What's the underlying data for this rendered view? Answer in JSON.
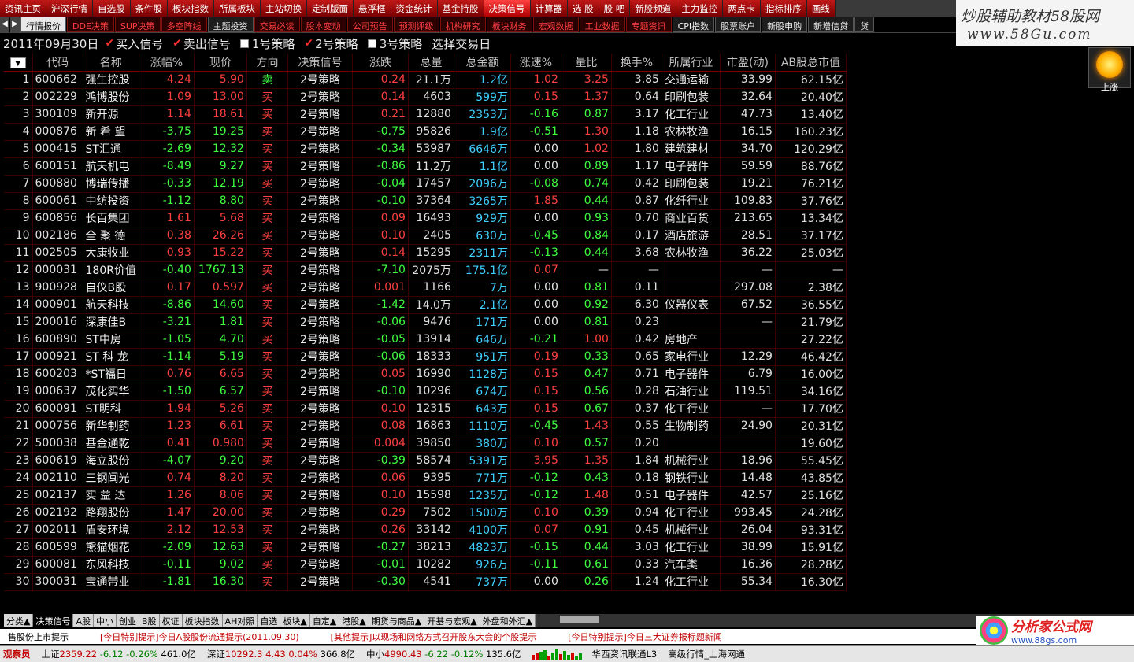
{
  "window_title": "",
  "top_nav": [
    "资讯主页",
    "沪深行情",
    "自选股",
    "条件股",
    "板块指数",
    "所属板块",
    "主站切换",
    "定制版面",
    "悬浮框",
    "资金统计",
    "基金持股",
    "决策信号",
    "计算器",
    "选 股",
    "股 吧",
    "新股频道",
    "主力监控",
    "两点卡",
    "指标排序",
    "画线"
  ],
  "top_nav_active": 11,
  "watermark": {
    "line1": "炒股辅助教材58股网",
    "line2": "www.58Gu.com"
  },
  "sub_tabs": [
    "行情报价",
    "DDE决策",
    "SUP决策",
    "多空阵线",
    "主题投资",
    "交易必读",
    "股本变动",
    "公司预告",
    "预测评级",
    "机构研究",
    "板块财务",
    "宏观数据",
    "工业数据",
    "专题资讯",
    "CPI指数",
    "股票账户",
    "新股申购",
    "新增信贷",
    "货"
  ],
  "sub_tabs_red": [
    1,
    2,
    3,
    5,
    6,
    7,
    8,
    9,
    10,
    11,
    12,
    13
  ],
  "signal_bar": {
    "date": "2011年09月30日",
    "options": [
      {
        "label": "买入信号",
        "checked": true
      },
      {
        "label": "卖出信号",
        "checked": true
      },
      {
        "label": "1号策略",
        "checked": false
      },
      {
        "label": "2号策略",
        "checked": true
      },
      {
        "label": "3号策略",
        "checked": false
      }
    ],
    "select_day": "选择交易日"
  },
  "up_button": {
    "label": "上涨"
  },
  "table": {
    "sort_arrow": "▼",
    "headers": [
      "代码",
      "名称",
      "涨幅%",
      "现价",
      "方向",
      "决策信号",
      "涨跌",
      "总量",
      "总金额",
      "涨速%",
      "量比",
      "换手%",
      "所属行业",
      "市盈(动)",
      "AB股总市值"
    ],
    "rows": [
      [
        "1",
        "600662",
        "强生控股",
        "4.24",
        "5.90",
        "卖",
        "2号策略",
        "0.24",
        "21.1万",
        "1.2亿",
        "1.02",
        "3.25",
        "3.85",
        "交通运输",
        "33.99",
        "62.15亿"
      ],
      [
        "2",
        "002229",
        "鸿博股份",
        "1.09",
        "13.00",
        "买",
        "2号策略",
        "0.14",
        "4603",
        "599万",
        "0.15",
        "1.37",
        "0.64",
        "印刷包装",
        "32.64",
        "20.40亿"
      ],
      [
        "3",
        "300109",
        "新开源",
        "1.14",
        "18.61",
        "买",
        "2号策略",
        "0.21",
        "12880",
        "2353万",
        "-0.16",
        "0.87",
        "3.17",
        "化工行业",
        "47.73",
        "13.40亿"
      ],
      [
        "4",
        "000876",
        "新 希 望",
        "-3.75",
        "19.25",
        "买",
        "2号策略",
        "-0.75",
        "95826",
        "1.9亿",
        "-0.51",
        "1.30",
        "1.18",
        "农林牧渔",
        "16.15",
        "160.23亿"
      ],
      [
        "5",
        "000415",
        "ST汇通",
        "-2.69",
        "12.32",
        "买",
        "2号策略",
        "-0.34",
        "53987",
        "6646万",
        "0.00",
        "1.02",
        "1.80",
        "建筑建材",
        "34.70",
        "120.29亿"
      ],
      [
        "6",
        "600151",
        "航天机电",
        "-8.49",
        "9.27",
        "买",
        "2号策略",
        "-0.86",
        "11.2万",
        "1.1亿",
        "0.00",
        "0.89",
        "1.17",
        "电子器件",
        "59.59",
        "88.76亿"
      ],
      [
        "7",
        "600880",
        "博瑞传播",
        "-0.33",
        "12.19",
        "买",
        "2号策略",
        "-0.04",
        "17457",
        "2096万",
        "-0.08",
        "0.74",
        "0.42",
        "印刷包装",
        "19.21",
        "76.21亿"
      ],
      [
        "8",
        "600061",
        "中纺投资",
        "-1.12",
        "8.80",
        "买",
        "2号策略",
        "-0.10",
        "37364",
        "3265万",
        "1.85",
        "0.44",
        "0.87",
        "化纤行业",
        "109.83",
        "37.76亿"
      ],
      [
        "9",
        "600856",
        "长百集团",
        "1.61",
        "5.68",
        "买",
        "2号策略",
        "0.09",
        "16493",
        "929万",
        "0.00",
        "0.93",
        "0.70",
        "商业百货",
        "213.65",
        "13.34亿"
      ],
      [
        "10",
        "002186",
        "全 聚 德",
        "0.38",
        "26.26",
        "买",
        "2号策略",
        "0.10",
        "2405",
        "630万",
        "-0.45",
        "0.84",
        "0.17",
        "酒店旅游",
        "28.51",
        "37.17亿"
      ],
      [
        "11",
        "002505",
        "大康牧业",
        "0.93",
        "15.22",
        "买",
        "2号策略",
        "0.14",
        "15295",
        "2311万",
        "-0.13",
        "0.44",
        "3.68",
        "农林牧渔",
        "36.22",
        "25.03亿"
      ],
      [
        "12",
        "000031",
        "180R价值",
        "-0.40",
        "1767.13",
        "买",
        "2号策略",
        "-7.10",
        "2075万",
        "175.1亿",
        "0.07",
        "—",
        "—",
        "",
        "—",
        "—"
      ],
      [
        "13",
        "900928",
        "自仪B股",
        "0.17",
        "0.597",
        "买",
        "2号策略",
        "0.001",
        "1166",
        "7万",
        "0.00",
        "0.81",
        "0.11",
        "",
        "297.08",
        "2.38亿"
      ],
      [
        "14",
        "000901",
        "航天科技",
        "-8.86",
        "14.60",
        "买",
        "2号策略",
        "-1.42",
        "14.0万",
        "2.1亿",
        "0.00",
        "0.92",
        "6.30",
        "仪器仪表",
        "67.52",
        "36.55亿"
      ],
      [
        "15",
        "200016",
        "深康佳B",
        "-3.21",
        "1.81",
        "买",
        "2号策略",
        "-0.06",
        "9476",
        "171万",
        "0.00",
        "0.81",
        "0.23",
        "",
        "—",
        "21.79亿"
      ],
      [
        "16",
        "600890",
        "ST中房",
        "-1.05",
        "4.70",
        "买",
        "2号策略",
        "-0.05",
        "13914",
        "646万",
        "-0.21",
        "1.00",
        "0.42",
        "房地产",
        "",
        "27.22亿"
      ],
      [
        "17",
        "000921",
        "ST 科 龙",
        "-1.14",
        "5.19",
        "买",
        "2号策略",
        "-0.06",
        "18333",
        "951万",
        "0.19",
        "0.33",
        "0.65",
        "家电行业",
        "12.29",
        "46.42亿"
      ],
      [
        "18",
        "600203",
        "*ST福日",
        "0.76",
        "6.65",
        "买",
        "2号策略",
        "0.05",
        "16990",
        "1128万",
        "0.15",
        "0.47",
        "0.71",
        "电子器件",
        "6.79",
        "16.00亿"
      ],
      [
        "19",
        "000637",
        "茂化实华",
        "-1.50",
        "6.57",
        "买",
        "2号策略",
        "-0.10",
        "10296",
        "674万",
        "0.15",
        "0.56",
        "0.28",
        "石油行业",
        "119.51",
        "34.16亿"
      ],
      [
        "20",
        "600091",
        "ST明科",
        "1.94",
        "5.26",
        "买",
        "2号策略",
        "0.10",
        "12315",
        "643万",
        "0.15",
        "0.67",
        "0.37",
        "化工行业",
        "—",
        "17.70亿"
      ],
      [
        "21",
        "000756",
        "新华制药",
        "1.23",
        "6.61",
        "买",
        "2号策略",
        "0.08",
        "16863",
        "1110万",
        "-0.45",
        "1.43",
        "0.55",
        "生物制药",
        "24.90",
        "20.31亿"
      ],
      [
        "22",
        "500038",
        "基金通乾",
        "0.41",
        "0.980",
        "买",
        "2号策略",
        "0.004",
        "39850",
        "380万",
        "0.10",
        "0.57",
        "0.20",
        "",
        "",
        "19.60亿"
      ],
      [
        "23",
        "600619",
        "海立股份",
        "-4.07",
        "9.20",
        "买",
        "2号策略",
        "-0.39",
        "58574",
        "5391万",
        "3.95",
        "1.35",
        "1.84",
        "机械行业",
        "18.96",
        "55.45亿"
      ],
      [
        "24",
        "002110",
        "三钢闽光",
        "0.74",
        "8.20",
        "买",
        "2号策略",
        "0.06",
        "9395",
        "771万",
        "-0.12",
        "0.43",
        "0.18",
        "钢铁行业",
        "14.48",
        "43.85亿"
      ],
      [
        "25",
        "002137",
        "实 益 达",
        "1.26",
        "8.06",
        "买",
        "2号策略",
        "0.10",
        "15598",
        "1235万",
        "-0.12",
        "1.48",
        "0.51",
        "电子器件",
        "42.57",
        "25.16亿"
      ],
      [
        "26",
        "002192",
        "路翔股份",
        "1.47",
        "20.00",
        "买",
        "2号策略",
        "0.29",
        "7502",
        "1500万",
        "0.10",
        "0.39",
        "0.94",
        "化工行业",
        "993.45",
        "24.28亿"
      ],
      [
        "27",
        "002011",
        "盾安环境",
        "2.12",
        "12.53",
        "买",
        "2号策略",
        "0.26",
        "33142",
        "4100万",
        "0.07",
        "0.91",
        "0.45",
        "机械行业",
        "26.04",
        "93.31亿"
      ],
      [
        "28",
        "600599",
        "熊猫烟花",
        "-2.09",
        "12.63",
        "买",
        "2号策略",
        "-0.27",
        "38213",
        "4823万",
        "-0.15",
        "0.44",
        "3.03",
        "化工行业",
        "38.99",
        "15.91亿"
      ],
      [
        "29",
        "600081",
        "东风科技",
        "-0.11",
        "9.02",
        "买",
        "2号策略",
        "-0.01",
        "10282",
        "926万",
        "-0.11",
        "0.61",
        "0.33",
        "汽车类",
        "16.36",
        "28.28亿"
      ],
      [
        "30",
        "300031",
        "宝通带业",
        "-1.81",
        "16.30",
        "买",
        "2号策略",
        "-0.30",
        "4541",
        "737万",
        "0.00",
        "0.26",
        "1.24",
        "化工行业",
        "55.34",
        "16.30亿"
      ]
    ]
  },
  "bottom_tabs": [
    "分类▲",
    "决策信号",
    "A股",
    "中小",
    "创业",
    "B股",
    "权证",
    "板块指数",
    "AH对照",
    "自选",
    "板块▲",
    "自定▲",
    "港股▲",
    "期货与商品▲",
    "开基与宏观▲",
    "外盘和外汇▲"
  ],
  "bottom_tabs_active": 1,
  "info_bar": [
    "售股份上市提示",
    "[今日特别提示]今日A股股份流通提示(2011.09.30)",
    "[其他提示]以现场和网络方式召开股东大会的个股提示",
    "[今日特别提示]今日三大证券报标题新闻"
  ],
  "status_bar": {
    "sticker": "观察员",
    "sh": {
      "name": "上证",
      "value": "2359.22",
      "chg": "-6.12",
      "pct": "-0.26%",
      "amt": "461.0亿"
    },
    "sz": {
      "name": "深证",
      "value": "10292.3",
      "chg": "4.43",
      "pct": "0.04%",
      "amt": "366.8亿"
    },
    "zx": {
      "name": "中小",
      "value": "4990.43",
      "chg": "-6.22",
      "pct": "-0.12%",
      "amt": "135.6亿"
    },
    "server": "华西资讯联通L3",
    "mode": "高级行情_上海网通"
  },
  "logo": {
    "title": "分析家公式网",
    "url": "www.88gs.com"
  }
}
